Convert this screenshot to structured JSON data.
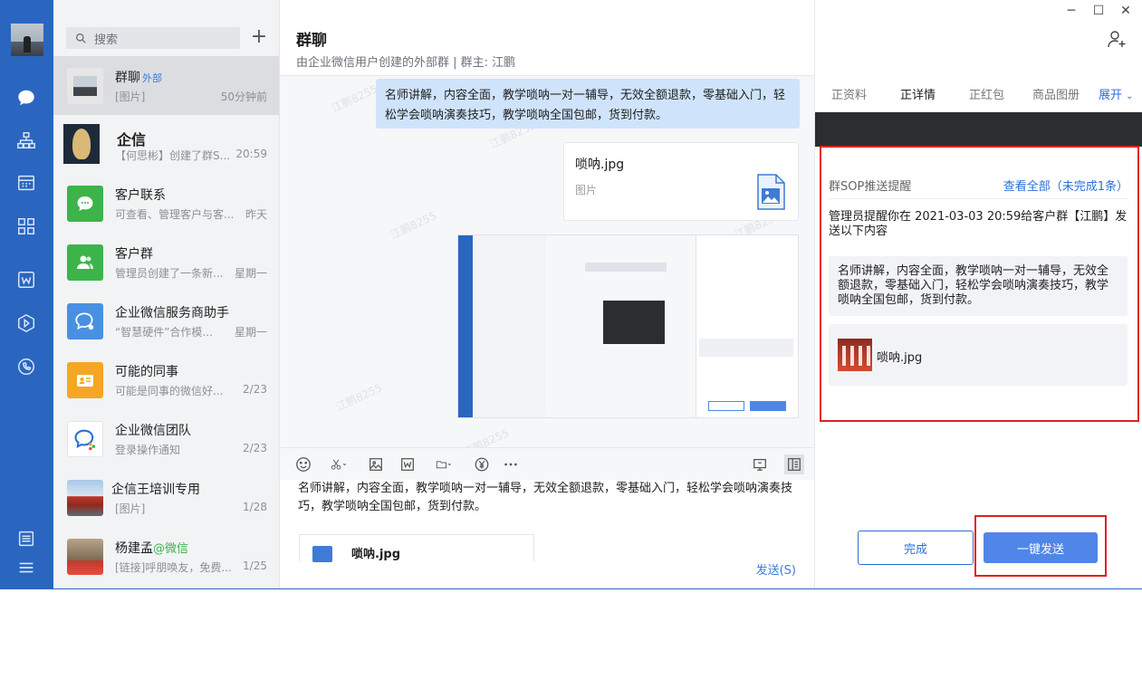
{
  "search": {
    "placeholder": "搜索"
  },
  "conversations": [
    {
      "name": "群聊",
      "tag": "外部",
      "sub": "[图片]",
      "time": "50分钟前"
    },
    {
      "name": "企信",
      "sub": "【何思彬】创建了群S...",
      "time": "20:59"
    },
    {
      "name": "客户联系",
      "sub": "可查看、管理客户与客...",
      "time": "昨天"
    },
    {
      "name": "客户群",
      "sub": "管理员创建了一条新...",
      "time": "星期一"
    },
    {
      "name": "企业微信服务商助手",
      "sub": "“智慧硬件”合作模...",
      "time": "星期一"
    },
    {
      "name": "可能的同事",
      "sub": "可能是同事的微信好...",
      "time": "2/23"
    },
    {
      "name": "企业微信团队",
      "sub": "登录操作通知",
      "time": "2/23"
    },
    {
      "name": "企信王培训专用",
      "sub": "[图片]",
      "time": "1/28"
    },
    {
      "name": "杨建孟",
      "tag": "@微信",
      "sub": "[链接]呼朋唤友，免费...",
      "time": "1/25"
    }
  ],
  "chat": {
    "title": "群聊",
    "subtitle": "由企业微信用户创建的外部群 | 群主: 江鹏",
    "message_text": "名师讲解，内容全面，教学唢呐一对一辅导，无效全额退款，零基础入门，轻松学会唢呐演奏技巧，教学唢呐全国包邮，货到付款。",
    "file_name": "唢呐.jpg",
    "file_kind": "图片",
    "watermark": "江鹏8255",
    "compose_text": "名师讲解，内容全面，教学唢呐一对一辅导，无效全额退款，零基础入门，轻松学会唢呐演奏技巧，教学唢呐全国包邮，货到付款。",
    "compose_file": "唢呐.jpg",
    "send_label": "发送(S)"
  },
  "panel": {
    "tabs": [
      "正资料",
      "正详情",
      "正红包",
      "商品图册"
    ],
    "expand_label": "展开",
    "sop_title": "群SOP推送提醒",
    "sop_link": "查看全部（未完成1条）",
    "sop_notice": "管理员提醒你在 2021-03-03 20:59给客户群【江鹏】发送以下内容",
    "sop_content": "名师讲解，内容全面，教学唢呐一对一辅导，无效全额退款，零基础入门，轻松学会唢呐演奏技巧，教学唢呐全国包邮，货到付款。",
    "sop_file": "唢呐.jpg",
    "done_label": "完成",
    "one_click_send_label": "一键发送"
  },
  "colors": {
    "accent": "#2b6fd6",
    "rail": "#2a66c0",
    "highlight": "#e02020"
  }
}
